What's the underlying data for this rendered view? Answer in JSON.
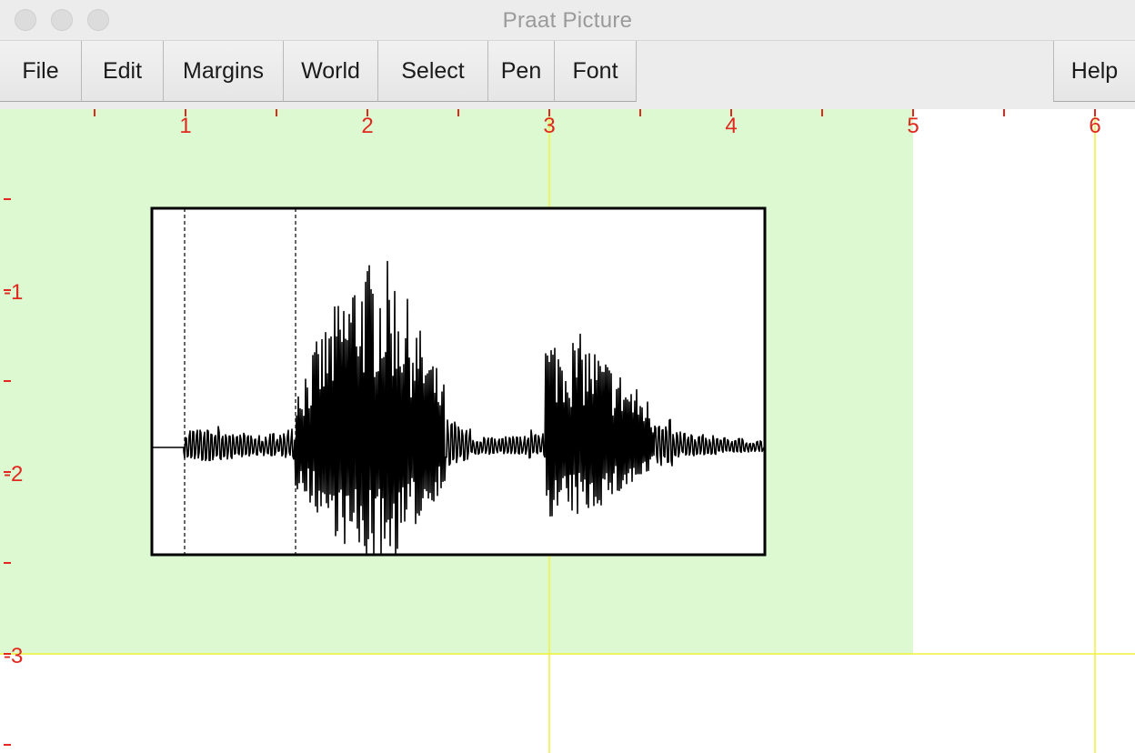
{
  "window": {
    "title": "Praat Picture"
  },
  "menubar": {
    "items": [
      {
        "label": "File"
      },
      {
        "label": "Edit"
      },
      {
        "label": "Margins"
      },
      {
        "label": "World"
      },
      {
        "label": "Select"
      },
      {
        "label": "Pen"
      },
      {
        "label": "Font"
      }
    ],
    "help": {
      "label": "Help"
    }
  },
  "canvas": {
    "x_ruler_labels": [
      "1",
      "2",
      "3",
      "4",
      "5",
      "6"
    ],
    "y_ruler_labels": [
      "-1",
      "-2",
      "-3"
    ],
    "colors": {
      "ruler": "#e0281e",
      "selection": "#dcf9d2",
      "guide": "#f2f23a",
      "ink": "#000000"
    }
  }
}
